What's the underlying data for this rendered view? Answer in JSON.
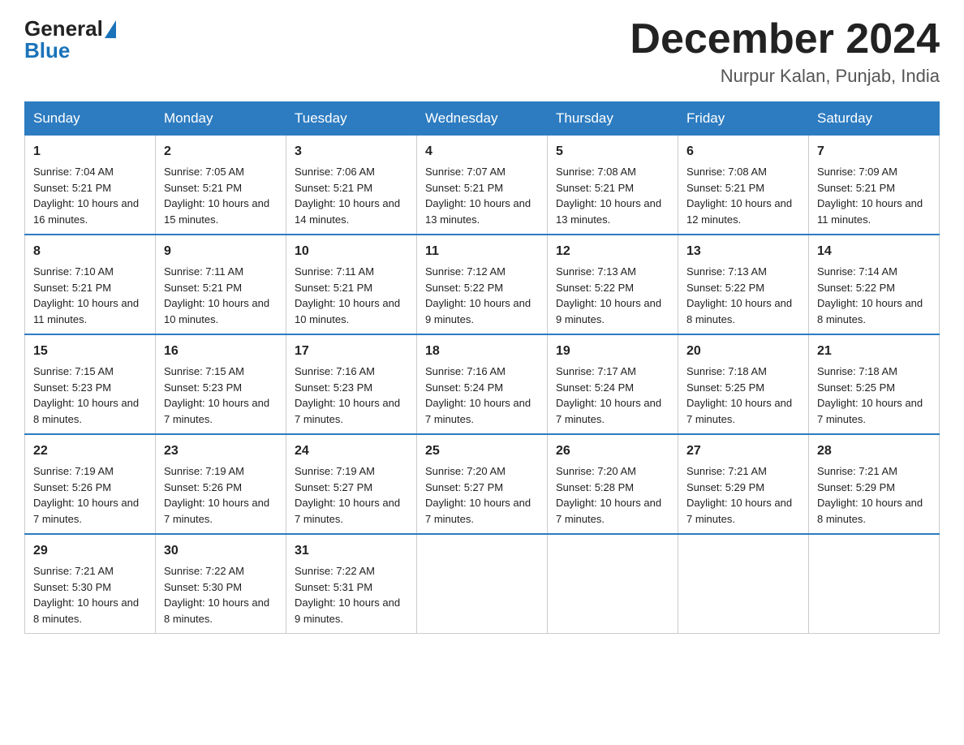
{
  "header": {
    "logo_general": "General",
    "logo_blue": "Blue",
    "month_title": "December 2024",
    "location": "Nurpur Kalan, Punjab, India"
  },
  "weekdays": [
    "Sunday",
    "Monday",
    "Tuesday",
    "Wednesday",
    "Thursday",
    "Friday",
    "Saturday"
  ],
  "weeks": [
    [
      {
        "day": "1",
        "sunrise": "7:04 AM",
        "sunset": "5:21 PM",
        "daylight": "10 hours and 16 minutes."
      },
      {
        "day": "2",
        "sunrise": "7:05 AM",
        "sunset": "5:21 PM",
        "daylight": "10 hours and 15 minutes."
      },
      {
        "day": "3",
        "sunrise": "7:06 AM",
        "sunset": "5:21 PM",
        "daylight": "10 hours and 14 minutes."
      },
      {
        "day": "4",
        "sunrise": "7:07 AM",
        "sunset": "5:21 PM",
        "daylight": "10 hours and 13 minutes."
      },
      {
        "day": "5",
        "sunrise": "7:08 AM",
        "sunset": "5:21 PM",
        "daylight": "10 hours and 13 minutes."
      },
      {
        "day": "6",
        "sunrise": "7:08 AM",
        "sunset": "5:21 PM",
        "daylight": "10 hours and 12 minutes."
      },
      {
        "day": "7",
        "sunrise": "7:09 AM",
        "sunset": "5:21 PM",
        "daylight": "10 hours and 11 minutes."
      }
    ],
    [
      {
        "day": "8",
        "sunrise": "7:10 AM",
        "sunset": "5:21 PM",
        "daylight": "10 hours and 11 minutes."
      },
      {
        "day": "9",
        "sunrise": "7:11 AM",
        "sunset": "5:21 PM",
        "daylight": "10 hours and 10 minutes."
      },
      {
        "day": "10",
        "sunrise": "7:11 AM",
        "sunset": "5:21 PM",
        "daylight": "10 hours and 10 minutes."
      },
      {
        "day": "11",
        "sunrise": "7:12 AM",
        "sunset": "5:22 PM",
        "daylight": "10 hours and 9 minutes."
      },
      {
        "day": "12",
        "sunrise": "7:13 AM",
        "sunset": "5:22 PM",
        "daylight": "10 hours and 9 minutes."
      },
      {
        "day": "13",
        "sunrise": "7:13 AM",
        "sunset": "5:22 PM",
        "daylight": "10 hours and 8 minutes."
      },
      {
        "day": "14",
        "sunrise": "7:14 AM",
        "sunset": "5:22 PM",
        "daylight": "10 hours and 8 minutes."
      }
    ],
    [
      {
        "day": "15",
        "sunrise": "7:15 AM",
        "sunset": "5:23 PM",
        "daylight": "10 hours and 8 minutes."
      },
      {
        "day": "16",
        "sunrise": "7:15 AM",
        "sunset": "5:23 PM",
        "daylight": "10 hours and 7 minutes."
      },
      {
        "day": "17",
        "sunrise": "7:16 AM",
        "sunset": "5:23 PM",
        "daylight": "10 hours and 7 minutes."
      },
      {
        "day": "18",
        "sunrise": "7:16 AM",
        "sunset": "5:24 PM",
        "daylight": "10 hours and 7 minutes."
      },
      {
        "day": "19",
        "sunrise": "7:17 AM",
        "sunset": "5:24 PM",
        "daylight": "10 hours and 7 minutes."
      },
      {
        "day": "20",
        "sunrise": "7:18 AM",
        "sunset": "5:25 PM",
        "daylight": "10 hours and 7 minutes."
      },
      {
        "day": "21",
        "sunrise": "7:18 AM",
        "sunset": "5:25 PM",
        "daylight": "10 hours and 7 minutes."
      }
    ],
    [
      {
        "day": "22",
        "sunrise": "7:19 AM",
        "sunset": "5:26 PM",
        "daylight": "10 hours and 7 minutes."
      },
      {
        "day": "23",
        "sunrise": "7:19 AM",
        "sunset": "5:26 PM",
        "daylight": "10 hours and 7 minutes."
      },
      {
        "day": "24",
        "sunrise": "7:19 AM",
        "sunset": "5:27 PM",
        "daylight": "10 hours and 7 minutes."
      },
      {
        "day": "25",
        "sunrise": "7:20 AM",
        "sunset": "5:27 PM",
        "daylight": "10 hours and 7 minutes."
      },
      {
        "day": "26",
        "sunrise": "7:20 AM",
        "sunset": "5:28 PM",
        "daylight": "10 hours and 7 minutes."
      },
      {
        "day": "27",
        "sunrise": "7:21 AM",
        "sunset": "5:29 PM",
        "daylight": "10 hours and 7 minutes."
      },
      {
        "day": "28",
        "sunrise": "7:21 AM",
        "sunset": "5:29 PM",
        "daylight": "10 hours and 8 minutes."
      }
    ],
    [
      {
        "day": "29",
        "sunrise": "7:21 AM",
        "sunset": "5:30 PM",
        "daylight": "10 hours and 8 minutes."
      },
      {
        "day": "30",
        "sunrise": "7:22 AM",
        "sunset": "5:30 PM",
        "daylight": "10 hours and 8 minutes."
      },
      {
        "day": "31",
        "sunrise": "7:22 AM",
        "sunset": "5:31 PM",
        "daylight": "10 hours and 9 minutes."
      },
      null,
      null,
      null,
      null
    ]
  ]
}
